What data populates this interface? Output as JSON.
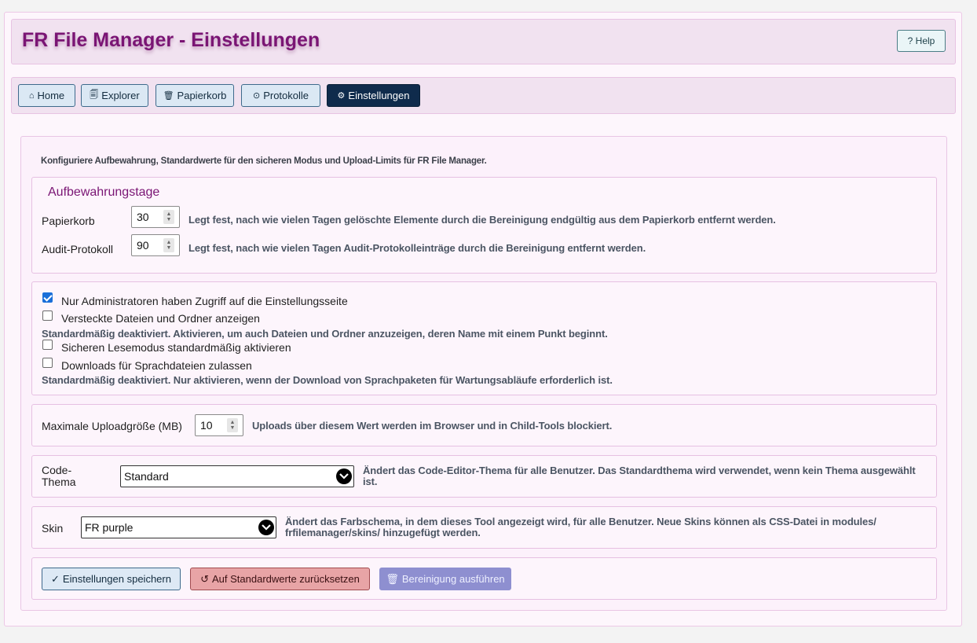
{
  "app": {
    "title": "FR File Manager - Einstellungen",
    "help_label": "? Help"
  },
  "nav": {
    "items": [
      {
        "icon": "⌂",
        "label": "Home",
        "active": false
      },
      {
        "icon": "🗐",
        "label": "Explorer",
        "active": false
      },
      {
        "icon": "🗑",
        "label": "Papierkorb",
        "active": false
      },
      {
        "icon": "⊙",
        "label": "Protokolle",
        "active": false
      },
      {
        "icon": "⚙",
        "label": "Einstellungen",
        "active": true
      }
    ]
  },
  "intro": "Konfiguriere Aufbewahrung, Standardwerte für den sicheren Modus und Upload-Limits für FR File Manager.",
  "retention": {
    "legend": "Aufbewahrungstage",
    "trash_label": "Papierkorb",
    "trash_value": "30",
    "trash_help": "Legt fest, nach wie vielen Tagen gelöschte Elemente durch die Bereinigung endgültig aus dem Papierkorb entfernt werden.",
    "audit_label": "Audit-Protokoll",
    "audit_value": "90",
    "audit_help": "Legt fest, nach wie vielen Tagen Audit-Protokolleinträge durch die Bereinigung entfernt werden."
  },
  "options": {
    "admin_only_label": "Nur Administratoren haben Zugriff auf die Einstellungsseite",
    "admin_only_checked": true,
    "show_hidden_label": "Versteckte Dateien und Ordner anzeigen",
    "show_hidden_checked": false,
    "show_hidden_help": "Standardmäßig deaktiviert. Aktivieren, um auch Dateien und Ordner anzuzeigen, deren Name mit einem Punkt beginnt.",
    "safe_read_label": "Sicheren Lesemodus standardmäßig aktivieren",
    "safe_read_checked": false,
    "lang_download_label": "Downloads für Sprachdateien zulassen",
    "lang_download_checked": false,
    "lang_download_help": "Standardmäßig deaktiviert. Nur aktivieren, wenn der Download von Sprachpaketen für Wartungsabläufe erforderlich ist."
  },
  "upload": {
    "label": "Maximale Uploadgröße (MB)",
    "value": "10",
    "help": "Uploads über diesem Wert werden im Browser und in Child-Tools blockiert."
  },
  "code_theme": {
    "label_line1": "Code-",
    "label_line2": "Thema",
    "value": "Standard",
    "help": "Ändert das Code-Editor-Thema für alle Benutzer. Das Standardthema wird verwendet, wenn kein Thema ausgewählt ist."
  },
  "skin": {
    "label": "Skin",
    "value": "FR purple",
    "help": "Ändert das Farbschema, in dem dieses Tool angezeigt wird, für alle Benutzer. Neue Skins können als CSS-Datei in modules/ frfilemanager/skins/ hinzugefügt werden."
  },
  "actions": {
    "save": {
      "icon": "✓",
      "label": "Einstellungen speichern",
      "color": "#dde9f5"
    },
    "reset": {
      "icon": "↺",
      "label": "Auf Standardwerte zurücksetzen",
      "color": "#e8a4a6"
    },
    "cleanup": {
      "icon": "🗑",
      "label": "Bereinigung ausführen",
      "color": "#8e8fd0"
    }
  }
}
